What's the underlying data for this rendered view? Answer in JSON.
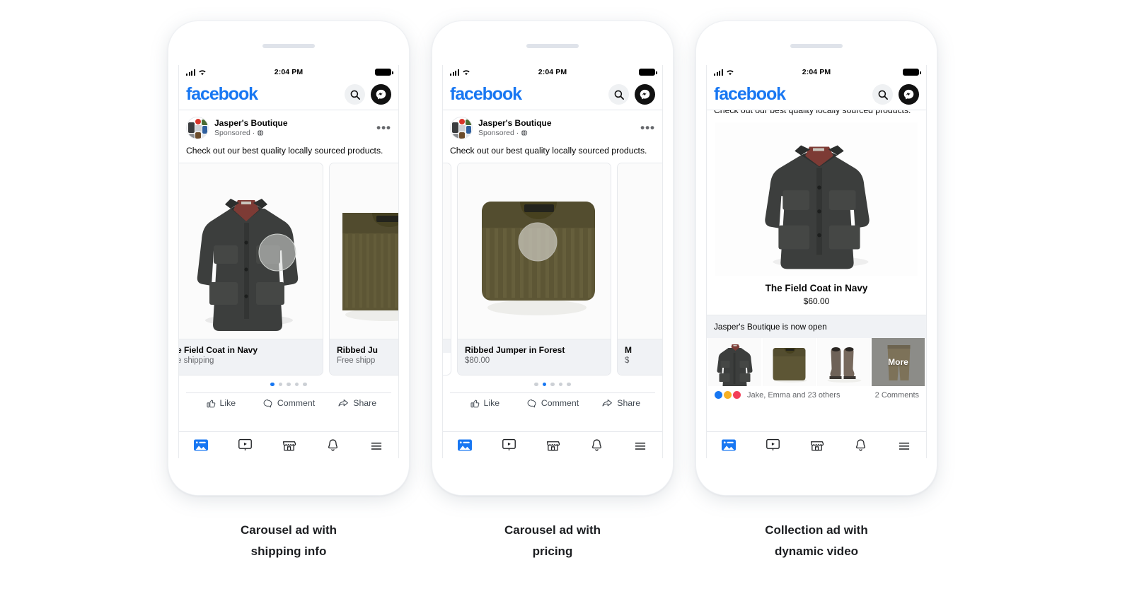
{
  "statusbar": {
    "time": "2:04 PM",
    "signal_icon": "cellular-bars-icon",
    "wifi_icon": "wifi-icon",
    "battery_icon": "battery-full-icon"
  },
  "header": {
    "logo": "facebook",
    "search_icon": "search-icon",
    "messenger_icon": "messenger-icon"
  },
  "post": {
    "page_name": "Jasper's Boutique",
    "sponsored_label": "Sponsored",
    "separator": "·",
    "privacy_icon": "globe-icon",
    "menu_icon": "ellipsis-icon",
    "body_text": "Check out our best quality locally sourced products."
  },
  "actions": {
    "like": "Like",
    "comment": "Comment",
    "share": "Share",
    "like_icon": "thumbs-up-icon",
    "comment_icon": "comment-bubble-icon",
    "share_icon": "share-arrow-icon"
  },
  "bottom_nav": [
    {
      "name": "news-feed",
      "icon": "news-feed-icon",
      "active": true
    },
    {
      "name": "watch",
      "icon": "watch-video-icon",
      "active": false
    },
    {
      "name": "marketplace",
      "icon": "marketplace-store-icon",
      "active": false
    },
    {
      "name": "notifications",
      "icon": "notification-bell-icon",
      "active": false
    },
    {
      "name": "menu",
      "icon": "hamburger-menu-icon",
      "active": false
    }
  ],
  "phone1": {
    "caption_line1": "Carousel ad with",
    "caption_line2": "shipping info",
    "cards": [
      {
        "title": "e Field Coat in Navy",
        "sub": "e shipping",
        "image": "dark-field-jacket-photo"
      },
      {
        "title": "Ribbed Ju",
        "sub": "Free shipp",
        "image": "olive-knit-sweater-photo"
      }
    ],
    "pager": {
      "count": 5,
      "active": 0
    }
  },
  "phone2": {
    "caption_line1": "Carousel ad with",
    "caption_line2": "pricing",
    "cards": [
      {
        "title": "",
        "sub": "",
        "image": "dark-field-jacket-photo-partial"
      },
      {
        "title": "Ribbed Jumper in Forest",
        "sub": "$80.00",
        "image": "olive-knit-sweater-photo"
      },
      {
        "title": "M",
        "sub": "$",
        "image": "next-product-photo-partial"
      }
    ],
    "pager": {
      "count": 5,
      "active": 1
    }
  },
  "phone3": {
    "caption_line1": "Collection ad with",
    "caption_line2": "dynamic video",
    "clipped_text": "Check out our best quality locally sourced products.",
    "hero_image": "dark-field-jacket-photo",
    "product_title": "The Field Coat in Navy",
    "product_price": "$60.00",
    "banner_text": "Jasper's Boutique is now open",
    "thumbnails": [
      {
        "image": "dark-field-jacket-thumb",
        "label": ""
      },
      {
        "image": "olive-sweater-thumb",
        "label": ""
      },
      {
        "image": "brown-boots-thumb",
        "label": ""
      },
      {
        "image": "khaki-trousers-thumb",
        "label": "More"
      }
    ],
    "reactions": {
      "text": "Jake, Emma and 23 others",
      "comments": "2 Comments"
    }
  },
  "colors": {
    "facebook_blue": "#1877F2",
    "text_primary": "#050505",
    "text_secondary": "#65676b",
    "card_caption_bg": "#f0f2f5",
    "jacket": "#3a3c3a",
    "sweater": "#5f5a3c",
    "more_overlay": "#8c8c88"
  }
}
